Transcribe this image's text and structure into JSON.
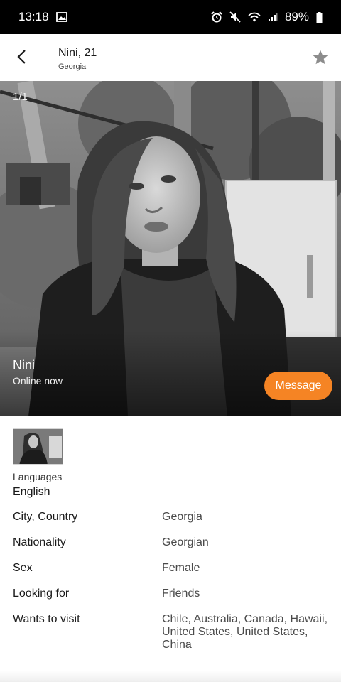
{
  "status_bar": {
    "time": "13:18",
    "battery": "89%",
    "icons": [
      "image-icon",
      "alarm-icon",
      "mute-icon",
      "wifi-icon",
      "signal-icon",
      "battery-icon"
    ]
  },
  "header": {
    "title": "Nini, 21",
    "subtitle": "Georgia",
    "back_icon": "back-arrow-icon",
    "favorite_icon": "star-icon"
  },
  "photo": {
    "counter": "1/1",
    "name": "Nini",
    "status": "Online now",
    "message_label": "Message"
  },
  "languages": {
    "label": "Languages",
    "value": "English"
  },
  "details": [
    {
      "label": "City, Country",
      "value": "Georgia"
    },
    {
      "label": "Nationality",
      "value": "Georgian"
    },
    {
      "label": "Sex",
      "value": "Female"
    },
    {
      "label": "Looking for",
      "value": "Friends"
    },
    {
      "label": "Wants to visit",
      "value": "Chile, Australia, Canada, Hawaii, United States, United States, China"
    }
  ],
  "colors": {
    "accent": "#f58424",
    "status_bar": "#000000",
    "star": "#8c8c8c"
  }
}
